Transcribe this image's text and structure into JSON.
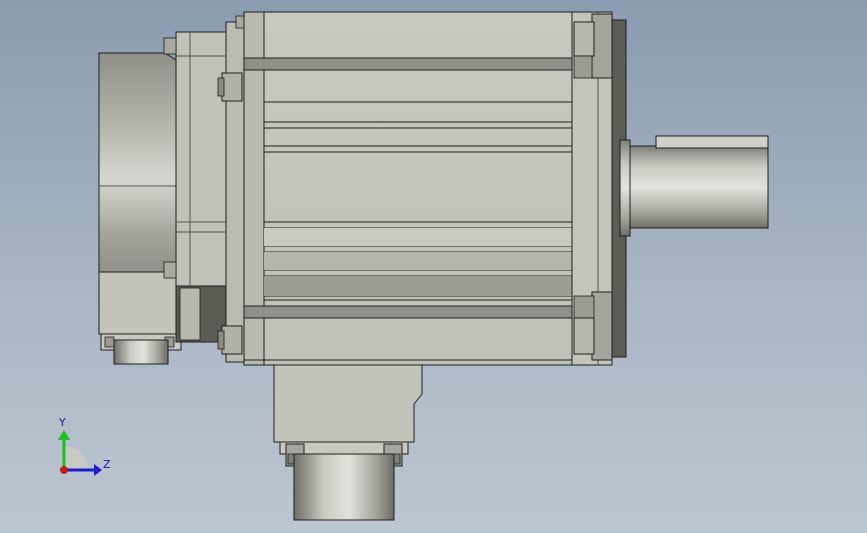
{
  "view": {
    "background_top": "#8a9cb0",
    "background_bottom": "#bcc6d0",
    "part_color": "#c4c6bc"
  },
  "triad": {
    "y_label": "Y",
    "z_label": "Z",
    "y_color": "#1cc21c",
    "z_color": "#1a1ad0",
    "x_color": "#d01a1a"
  }
}
